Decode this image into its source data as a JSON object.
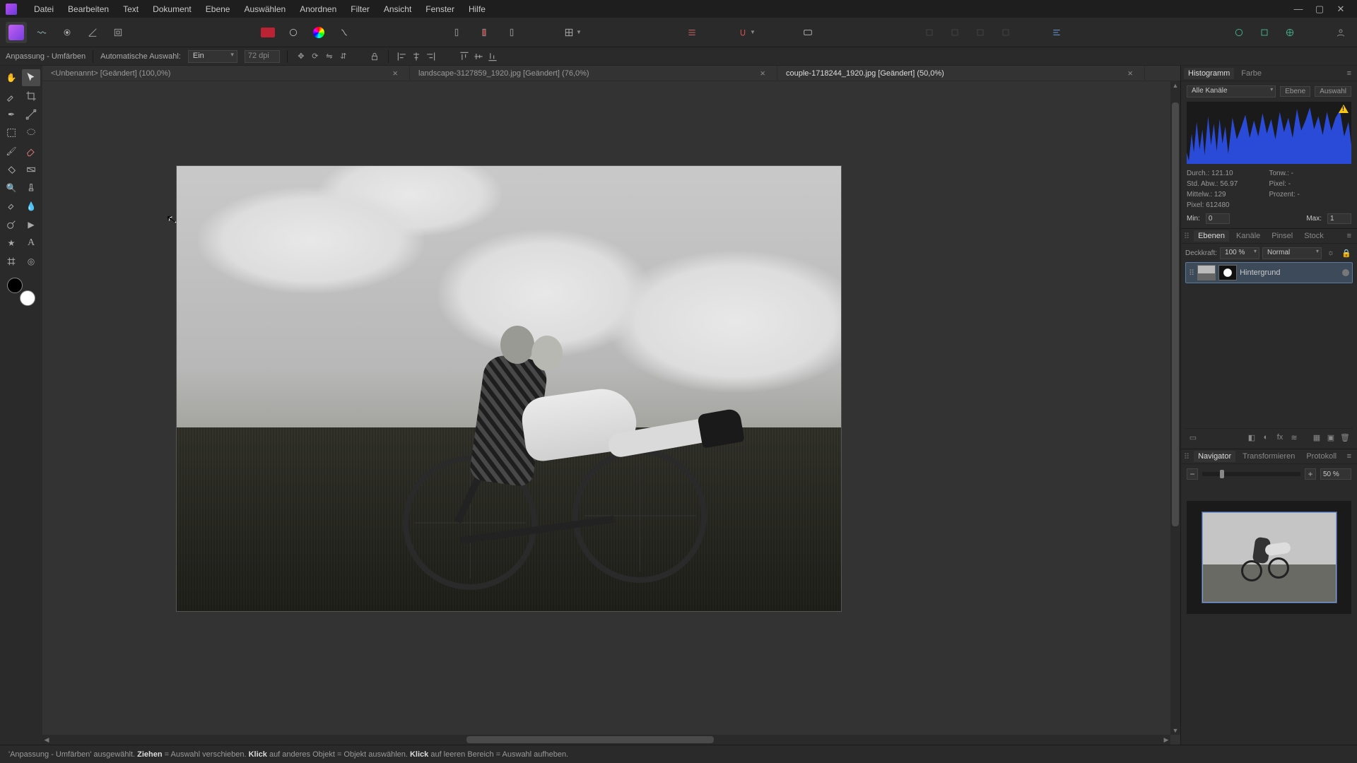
{
  "menu": [
    "Datei",
    "Bearbeiten",
    "Text",
    "Dokument",
    "Ebene",
    "Auswählen",
    "Anordnen",
    "Filter",
    "Ansicht",
    "Fenster",
    "Hilfe"
  ],
  "contextbar": {
    "tool_label": "Anpassung - Umfärben",
    "auto_select_label": "Automatische Auswahl:",
    "auto_select_value": "Ein",
    "dpi": "72 dpi"
  },
  "doc_tabs": [
    {
      "title": "<Unbenannt> [Geändert] (100,0%)",
      "active": false
    },
    {
      "title": "landscape-3127859_1920.jpg [Geändert] (76,0%)",
      "active": false
    },
    {
      "title": "couple-1718244_1920.jpg [Geändert] (50,0%)",
      "active": true
    }
  ],
  "panels": {
    "histogram": {
      "tabs": [
        "Histogramm",
        "Farbe"
      ],
      "channel": "Alle Kanäle",
      "btns": [
        "Ebene",
        "Auswahl"
      ],
      "stats": {
        "durch": "Durch.: 121.10",
        "stdabw": "Std. Abw.: 56.97",
        "mittelw": "Mittelw.: 129",
        "pixel": "Pixel: 612480",
        "tonw": "Tonw.: -",
        "pixel2": "Pixel: -",
        "prozent": "Prozent: -"
      },
      "min_label": "Min:",
      "min": "0",
      "max_label": "Max:",
      "max": "1"
    },
    "layers": {
      "tabs": [
        "Ebenen",
        "Kanäle",
        "Pinsel",
        "Stock"
      ],
      "opacity_label": "Deckkraft:",
      "opacity": "100 %",
      "blend": "Normal",
      "layer_name": "Hintergrund"
    },
    "navigator": {
      "tabs": [
        "Navigator",
        "Transformieren",
        "Protokoll"
      ],
      "zoom": "50 %"
    }
  },
  "status": {
    "parts": [
      {
        "t": "'Anpassung - Umfärben' ausgewählt. "
      },
      {
        "b": "Ziehen"
      },
      {
        "t": " = Auswahl verschieben. "
      },
      {
        "b": "Klick"
      },
      {
        "t": " auf anderes Objekt = Objekt auswählen. "
      },
      {
        "b": "Klick"
      },
      {
        "t": " auf leeren Bereich = Auswahl aufheben."
      }
    ]
  }
}
